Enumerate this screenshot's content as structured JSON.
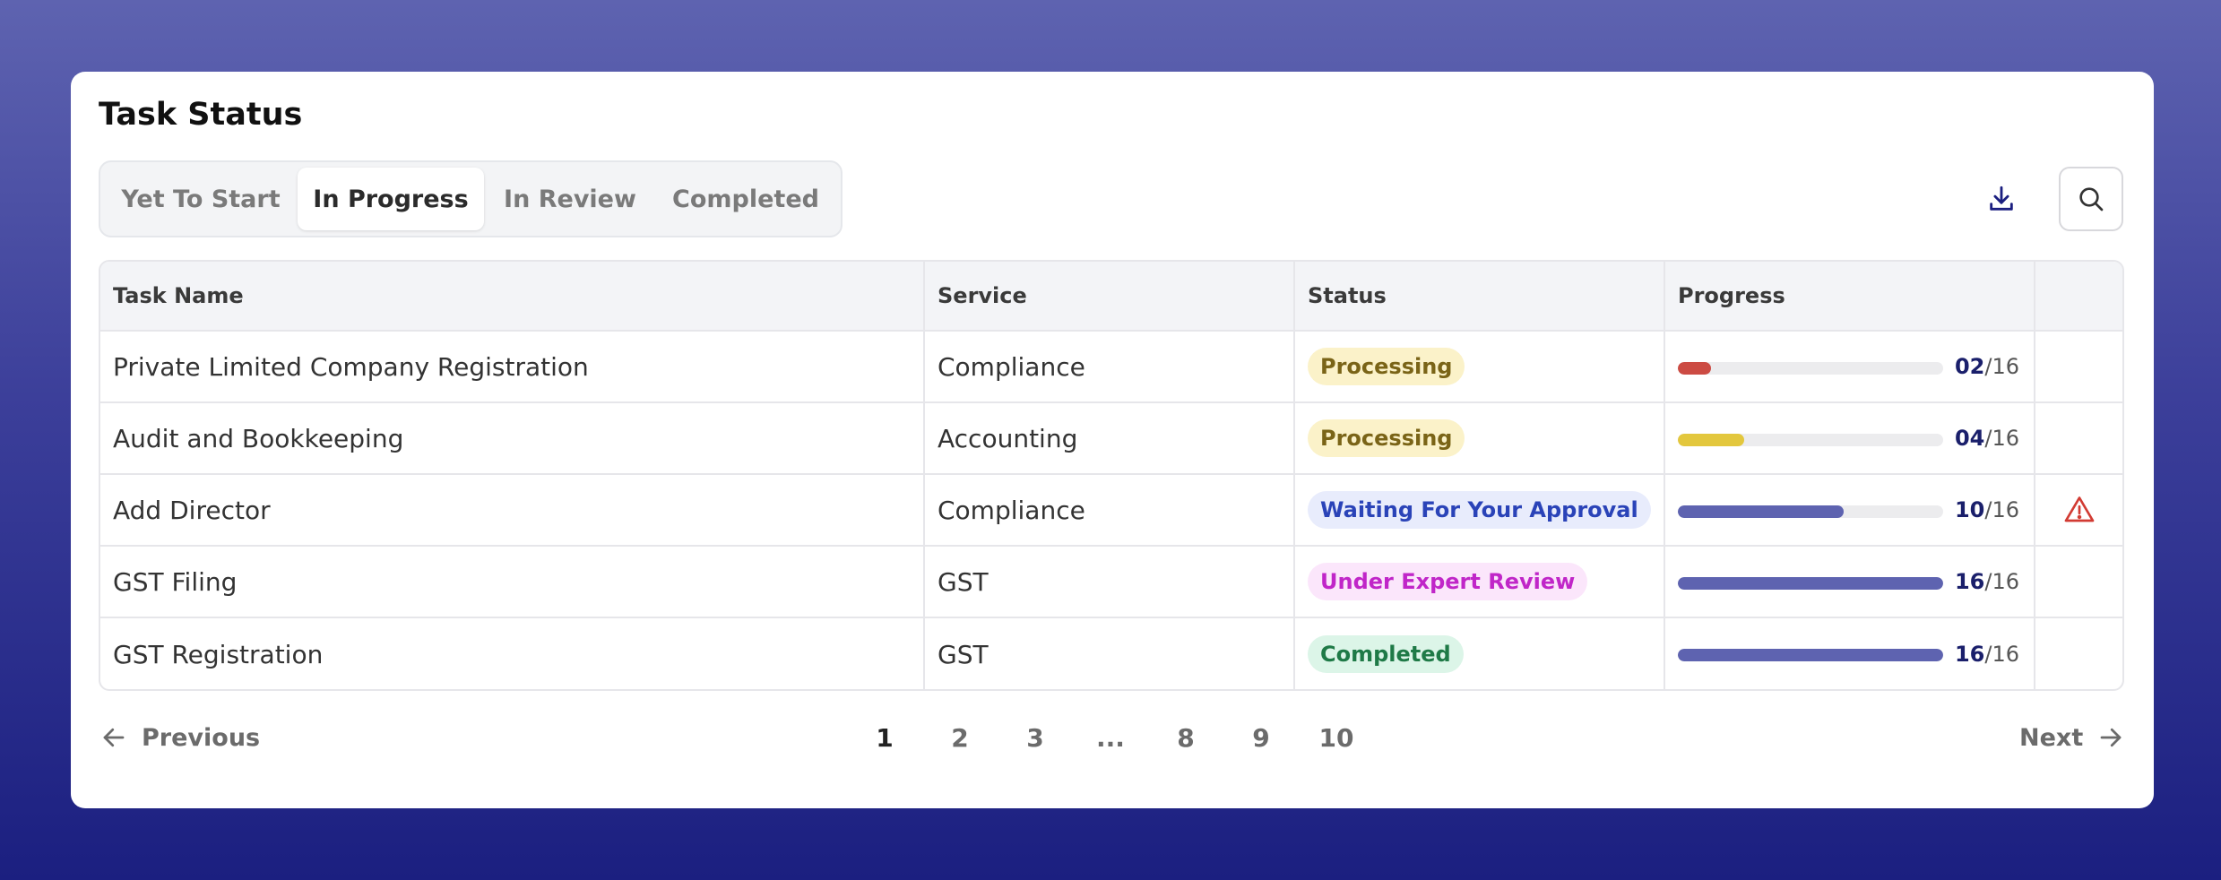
{
  "title": "Task Status",
  "tabs": [
    {
      "label": "Yet To Start",
      "active": false
    },
    {
      "label": "In Progress",
      "active": true
    },
    {
      "label": "In Review",
      "active": false
    },
    {
      "label": "Completed",
      "active": false
    }
  ],
  "toolbar": {
    "download_icon": "download-icon",
    "search_icon": "search-icon"
  },
  "table": {
    "headers": [
      "Task Name",
      "Service",
      "Status",
      "Progress",
      ""
    ],
    "rows": [
      {
        "task": "Private Limited Company Registration",
        "service": "Compliance",
        "status": "Processing",
        "status_bg": "#fbf2c9",
        "status_color": "#7a6417",
        "done": "02",
        "total": "/16",
        "fraction": 0.125,
        "bar_color": "#cc4b43",
        "alert": false
      },
      {
        "task": "Audit and Bookkeeping",
        "service": "Accounting",
        "status": "Processing",
        "status_bg": "#fbf2c9",
        "status_color": "#7a6417",
        "done": "04",
        "total": "/16",
        "fraction": 0.25,
        "bar_color": "#e3c73d",
        "alert": false
      },
      {
        "task": "Add Director",
        "service": "Compliance",
        "status": "Waiting For Your Approval",
        "status_bg": "#e8ecfc",
        "status_color": "#2a43b8",
        "done": "10",
        "total": "/16",
        "fraction": 0.625,
        "bar_color": "#5e63b0",
        "alert": true
      },
      {
        "task": "GST Filing",
        "service": "GST",
        "status": "Under Expert Review",
        "status_bg": "#fbe6fb",
        "status_color": "#c026c8",
        "done": "16",
        "total": "/16",
        "fraction": 1.0,
        "bar_color": "#5e63b0",
        "alert": false
      },
      {
        "task": "GST Registration",
        "service": "GST",
        "status": "Completed",
        "status_bg": "#dcf5e8",
        "status_color": "#1f7a47",
        "done": "16",
        "total": "/16",
        "fraction": 1.0,
        "bar_color": "#5e63b0",
        "alert": false
      }
    ]
  },
  "pagination": {
    "previous": "Previous",
    "next": "Next",
    "pages": [
      "1",
      "2",
      "3",
      "...",
      "8",
      "9",
      "10"
    ],
    "current": "1"
  },
  "colors": {
    "accent": "#5e63b0",
    "alert": "#d23b33"
  }
}
